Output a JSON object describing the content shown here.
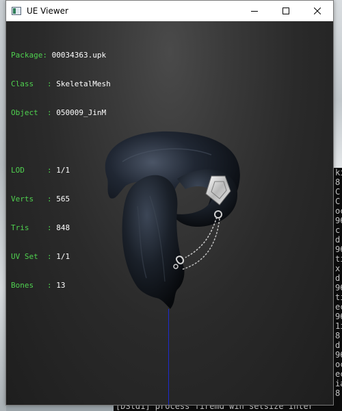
{
  "window": {
    "title": "UE Viewer",
    "controls": {
      "minimize": "minimize",
      "maximize": "maximize",
      "close": "close"
    }
  },
  "info": {
    "package_label": "Package",
    "package_value": "00034363.upk",
    "class_label": "Class",
    "class_value": "SkeletalMesh",
    "object_label": "Object",
    "object_value": "050009_JinM",
    "lod_label": "LOD",
    "lod_value": "1/1",
    "verts_label": "Verts",
    "verts_value": "565",
    "tris_label": "Tris",
    "tris_value": "848",
    "uvset_label": "UV Set",
    "uvset_value": "1/1",
    "bones_label": "Bones",
    "bones_value": "13"
  },
  "background_console": {
    "bottom_line": "[DStd1] process  firemd win setsize  inter"
  },
  "colors": {
    "label_green": "#4fd14f",
    "axis_blue": "#1d2bd1",
    "viewport_dark": "#2a2a2a"
  }
}
